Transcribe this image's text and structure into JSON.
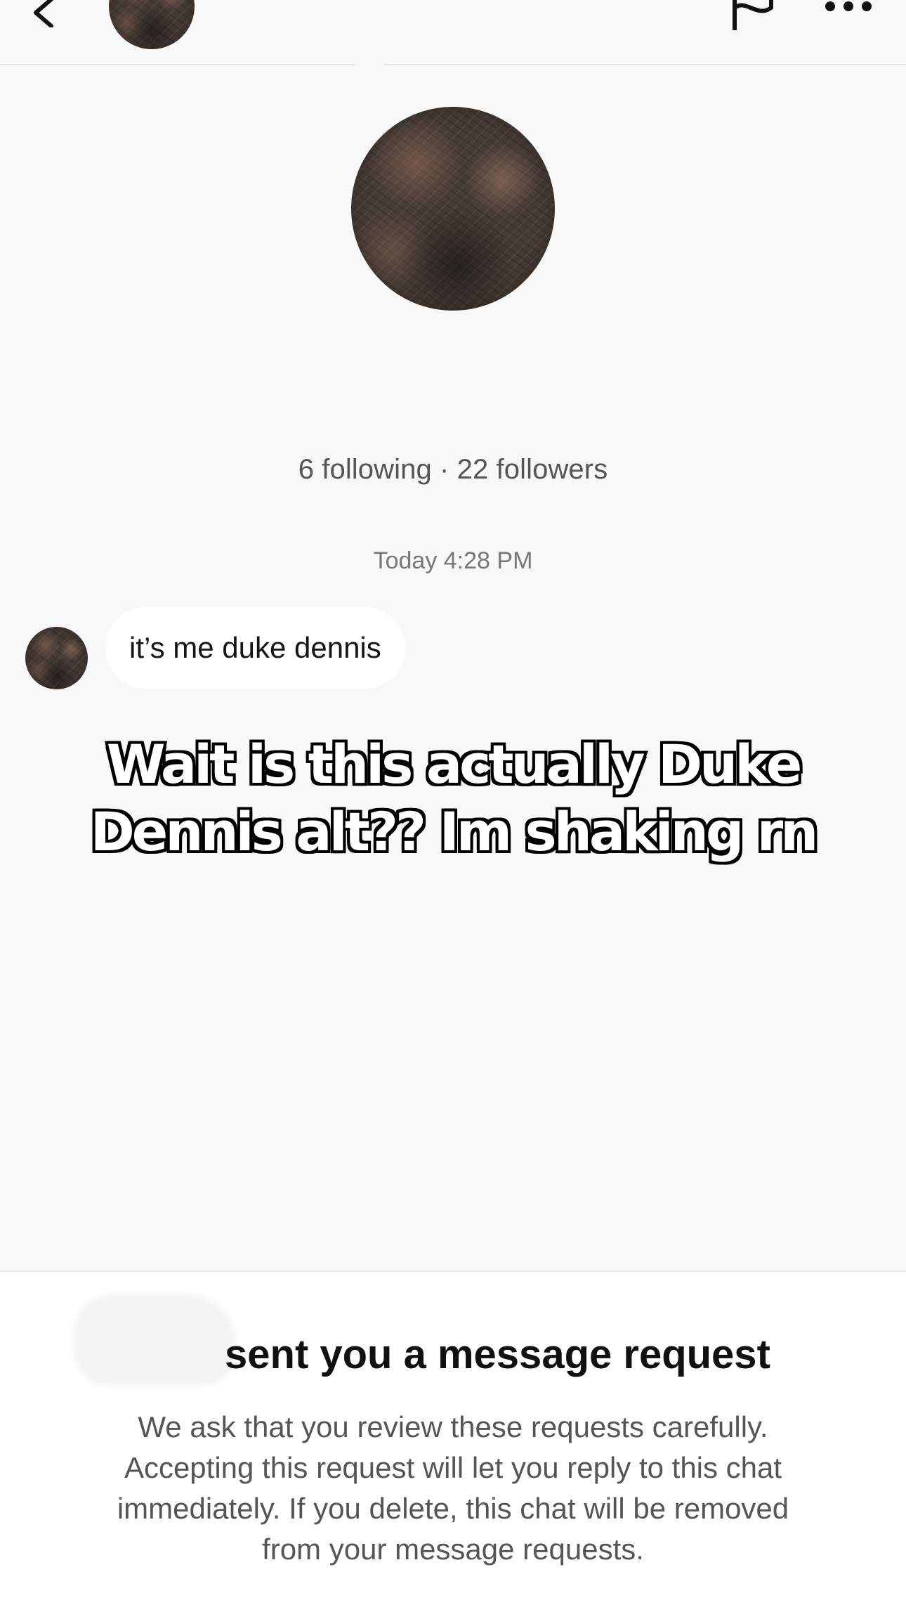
{
  "header": {
    "back_icon": "chevron-left-icon",
    "flag_icon": "flag-icon",
    "more_icon": "more-horizontal-icon"
  },
  "profile": {
    "stats": "6 following · 22 followers"
  },
  "conversation": {
    "timestamp": "Today 4:28 PM",
    "messages": [
      {
        "text": "it’s me duke dennis"
      }
    ]
  },
  "overlay": {
    "line1": "Wait is this actually Duke",
    "line2": "Dennis alt?? Im shaking rn"
  },
  "message_request": {
    "title": "sent you a message request",
    "description_lines": [
      "We ask that you review these requests carefully.",
      "Accepting this request will let you reply to this chat",
      "immediately. If you delete, this chat will be removed",
      "from your message requests."
    ]
  },
  "colors": {
    "background": "#f8f8f8",
    "bubble": "#ffffff",
    "text_primary": "#161616",
    "text_secondary": "#555555",
    "divider": "#e6e6e6",
    "caption_fill": "#ffffff",
    "caption_stroke": "#000000"
  }
}
